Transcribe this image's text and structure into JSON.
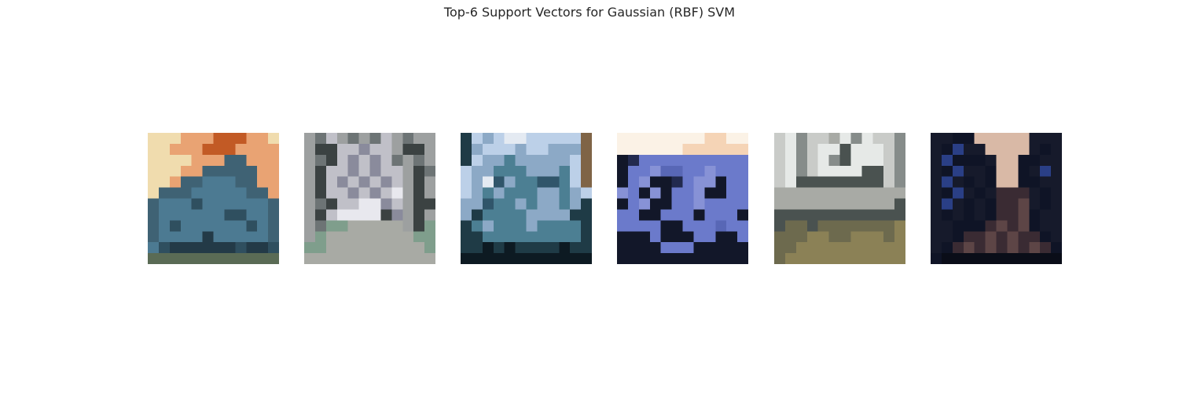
{
  "figure": {
    "title": "Top-6 Support Vectors for Gaussian (RBF) SVM"
  },
  "images": [
    {
      "alt": "support vector 1",
      "palette": [
        "#f0dcae",
        "#e9a373",
        "#c25a25",
        "#3f6274",
        "#4c7a92",
        "#2f4f5f",
        "#233a47",
        "#5a6b55"
      ]
    },
    {
      "alt": "support vector 2",
      "palette": [
        "#9da0a0",
        "#6d7475",
        "#c0c0c8",
        "#8a8b9c",
        "#3b4242",
        "#e8e8ee",
        "#7f9e8c",
        "#a8aaa4"
      ]
    },
    {
      "alt": "support vector 3",
      "palette": [
        "#bcd0e8",
        "#8ca9c6",
        "#4c7f93",
        "#1f3b46",
        "#e4eaf2",
        "#7f6446",
        "#30556a",
        "#0d1a22"
      ]
    },
    {
      "alt": "support vector 4",
      "palette": [
        "#fbf2e6",
        "#f5d4b6",
        "#6b7acb",
        "#5867b6",
        "#222a4e",
        "#121729",
        "#8792d6",
        "#3b4573"
      ]
    },
    {
      "alt": "support vector 5",
      "palette": [
        "#c9cbc8",
        "#e6e9e7",
        "#868c8a",
        "#4a5250",
        "#a8aaa5",
        "#6d6a4e",
        "#8b8156",
        "#555345"
      ]
    },
    {
      "alt": "support vector 6",
      "palette": [
        "#161a2b",
        "#0f1426",
        "#2a3f86",
        "#1b2a5a",
        "#d9b9a6",
        "#3a2b33",
        "#5d4546",
        "#0a0d18"
      ]
    }
  ]
}
